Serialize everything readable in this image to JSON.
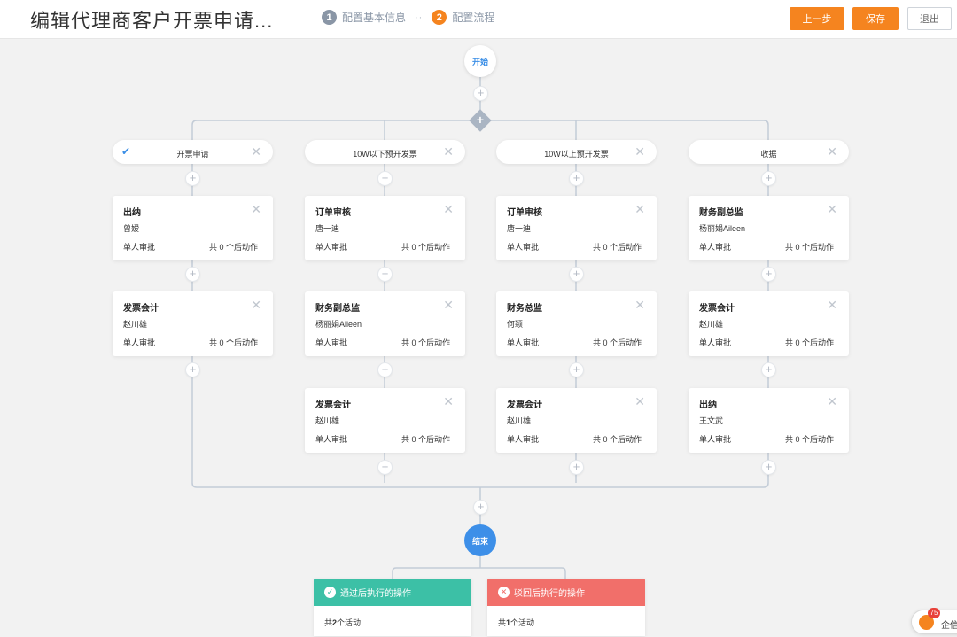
{
  "header": {
    "title": "编辑代理商客户开票申请...",
    "steps": [
      {
        "num": "1",
        "label": "配置基本信息"
      },
      {
        "num": "2",
        "label": "配置流程"
      }
    ],
    "step_separator": "··",
    "buttons": {
      "prev": "上一步",
      "save": "保存",
      "exit": "退出"
    }
  },
  "flow": {
    "start_label": "开始",
    "end_label": "结束",
    "branches": [
      {
        "label": "开票申请",
        "selected": true,
        "nodes": [
          {
            "title": "出纳",
            "person": "曾嫒",
            "type": "单人审批",
            "actions": "共 0 个后动作"
          },
          {
            "title": "发票会计",
            "person": "赵川雄",
            "type": "单人审批",
            "actions": "共 0 个后动作"
          }
        ]
      },
      {
        "label": "10W以下预开发票",
        "selected": false,
        "nodes": [
          {
            "title": "订单审核",
            "person": "唐一迪",
            "type": "单人审批",
            "actions": "共 0 个后动作"
          },
          {
            "title": "财务副总监",
            "person": "杨丽娟Aileen",
            "type": "单人审批",
            "actions": "共 0 个后动作"
          },
          {
            "title": "发票会计",
            "person": "赵川雄",
            "type": "单人审批",
            "actions": "共 0 个后动作"
          }
        ]
      },
      {
        "label": "10W以上预开发票",
        "selected": false,
        "nodes": [
          {
            "title": "订单审核",
            "person": "唐一迪",
            "type": "单人审批",
            "actions": "共 0 个后动作"
          },
          {
            "title": "财务总监",
            "person": "何颖",
            "type": "单人审批",
            "actions": "共 0 个后动作"
          },
          {
            "title": "发票会计",
            "person": "赵川雄",
            "type": "单人审批",
            "actions": "共 0 个后动作"
          }
        ]
      },
      {
        "label": "收据",
        "selected": false,
        "nodes": [
          {
            "title": "财务副总监",
            "person": "杨丽娟Aileen",
            "type": "单人审批",
            "actions": "共 0 个后动作"
          },
          {
            "title": "发票会计",
            "person": "赵川雄",
            "type": "单人审批",
            "actions": "共 0 个后动作"
          },
          {
            "title": "出纳",
            "person": "王文武",
            "type": "单人审批",
            "actions": "共 0 个后动作"
          }
        ]
      }
    ],
    "results": {
      "pass": {
        "title": "通过后执行的操作",
        "count_prefix": "共",
        "count": "2",
        "count_suffix": "个活动",
        "color": "#3cc0a6"
      },
      "reject": {
        "title": "驳回后执行的操作",
        "count_prefix": "共",
        "count": "1",
        "count_suffix": "个活动",
        "color": "#f16f6a"
      }
    }
  },
  "widget": {
    "badge": "75",
    "label": "企信"
  },
  "colors": {
    "accent": "#f5841f",
    "primary": "#3d8fe8",
    "connector": "#c3ccd7"
  }
}
